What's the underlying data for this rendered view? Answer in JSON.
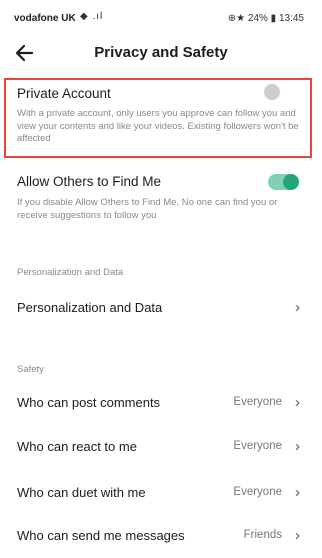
{
  "status_bar": {
    "carrier": "vodafone UK",
    "signal_icons": "◆ .ıl",
    "right_text": "⊕★ 24% ▮ 13:45"
  },
  "header": {
    "title": "Privacy and Safety"
  },
  "private_account": {
    "title": "Private Account",
    "description": "With a private account, only users you approve can follow you and view your contents and like your videos. Existing followers won't be affected",
    "enabled": false
  },
  "allow_find": {
    "title": "Allow Others to Find Me",
    "description": "If you disable Allow Others to Find Me, No one can find you or receive suggestions to follow you",
    "enabled": true
  },
  "sections": {
    "personalization_header": "Personalization and Data",
    "safety_header": "Safety"
  },
  "personalization_row": {
    "label": "Personalization and Data"
  },
  "safety_rows": [
    {
      "label": "Who can post comments",
      "value": "Everyone"
    },
    {
      "label": "Who can react to me",
      "value": "Everyone"
    },
    {
      "label": "Who can duet with me",
      "value": "Everyone"
    },
    {
      "label": "Who can send me messages",
      "value": "Friends"
    }
  ],
  "colors": {
    "toggle_on": "#22a577",
    "highlight_border": "#e8453c"
  }
}
